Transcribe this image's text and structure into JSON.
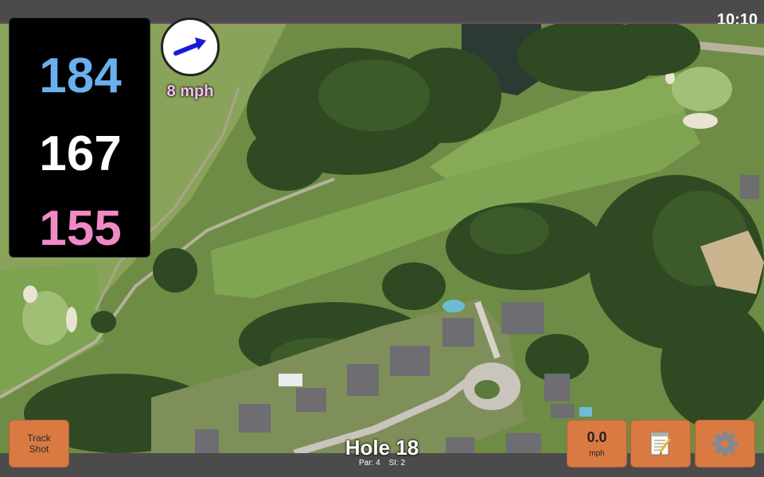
{
  "status": {
    "time": "10:10"
  },
  "distances": {
    "back": "184",
    "middle": "167",
    "front": "155"
  },
  "wind": {
    "speed_label": "8 mph",
    "direction_icon": "arrow-east-northeast"
  },
  "hole": {
    "title": "Hole 18",
    "par": "Par: 4",
    "stroke_index": "SI: 2"
  },
  "buttons": {
    "track_shot": "Track Shot",
    "wind_value": "0.0",
    "wind_unit": "mph",
    "notes_icon": "notepad-icon",
    "settings_icon": "gear-icon"
  },
  "colors": {
    "back": "#6ab0ee",
    "middle": "#ffffff",
    "front": "#f08ac6",
    "button": "#d97a43",
    "wind_label": "#f6c0f0"
  }
}
